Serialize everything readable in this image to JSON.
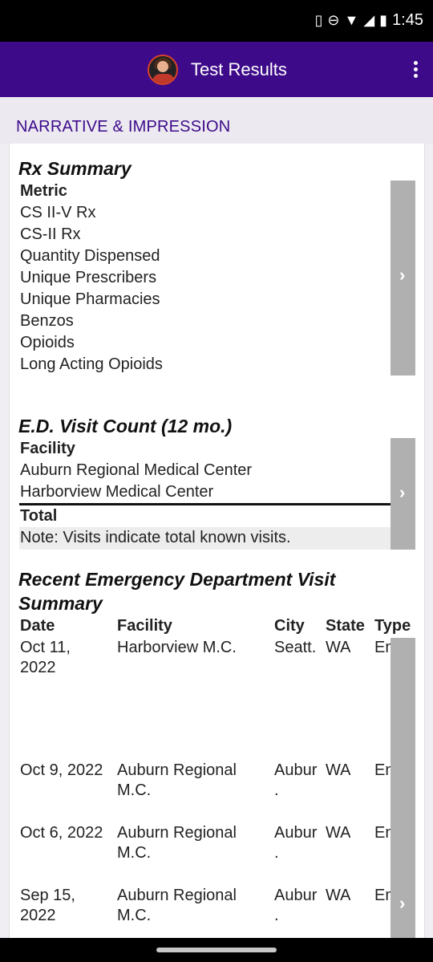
{
  "status_bar": {
    "time": "1:45",
    "icons": [
      "vibrate-icon",
      "dnd-icon",
      "wifi-icon",
      "signal-icon",
      "battery-icon"
    ]
  },
  "app_bar": {
    "title": "Test Results",
    "avatar": "avatar",
    "menu_icon": "more-vert-icon"
  },
  "section_title": "NARRATIVE & IMPRESSION",
  "rx_summary": {
    "heading": "Rx Summary",
    "column": "Metric",
    "rows": [
      "CS II-V Rx",
      "CS-II Rx",
      "Quantity Dispensed",
      "Unique Prescribers",
      "Unique Pharmacies",
      "Benzos",
      "Opioids",
      "Long Acting Opioids"
    ]
  },
  "ed_visit_count": {
    "heading": "E.D. Visit Count (12 mo.)",
    "column": "Facility",
    "rows": [
      "Auburn Regional Medical Center",
      "Harborview Medical Center"
    ],
    "total_label": "Total",
    "note": "Note: Visits indicate total known visits."
  },
  "recent_ed": {
    "heading_line1": "Recent Emergency Department Visit",
    "heading_line2": "Summary",
    "columns": [
      "Date",
      "Facility",
      "City",
      "State",
      "Type"
    ],
    "rows": [
      {
        "date1": "Oct 11,",
        "date2": "2022",
        "facility1": "Harborview M.C.",
        "facility2": "",
        "city1": "Seatt.",
        "city2": "",
        "state": "WA",
        "type": "Emerg"
      },
      {
        "date1": "Oct 9, 2022",
        "date2": "",
        "facility1": "Auburn Regional",
        "facility2": "M.C.",
        "city1": "Aubur",
        "city2": ".",
        "state": "WA",
        "type": "Emerg"
      },
      {
        "date1": "Oct 6, 2022",
        "date2": "",
        "facility1": "Auburn Regional",
        "facility2": "M.C.",
        "city1": "Aubur",
        "city2": ".",
        "state": "WA",
        "type": "Emerg"
      },
      {
        "date1": "Sep 15,",
        "date2": "2022",
        "facility1": "Auburn Regional",
        "facility2": "M.C.",
        "city1": "Aubur",
        "city2": ".",
        "state": "WA",
        "type": "Emerg"
      }
    ]
  },
  "scroll_chevron": "›"
}
